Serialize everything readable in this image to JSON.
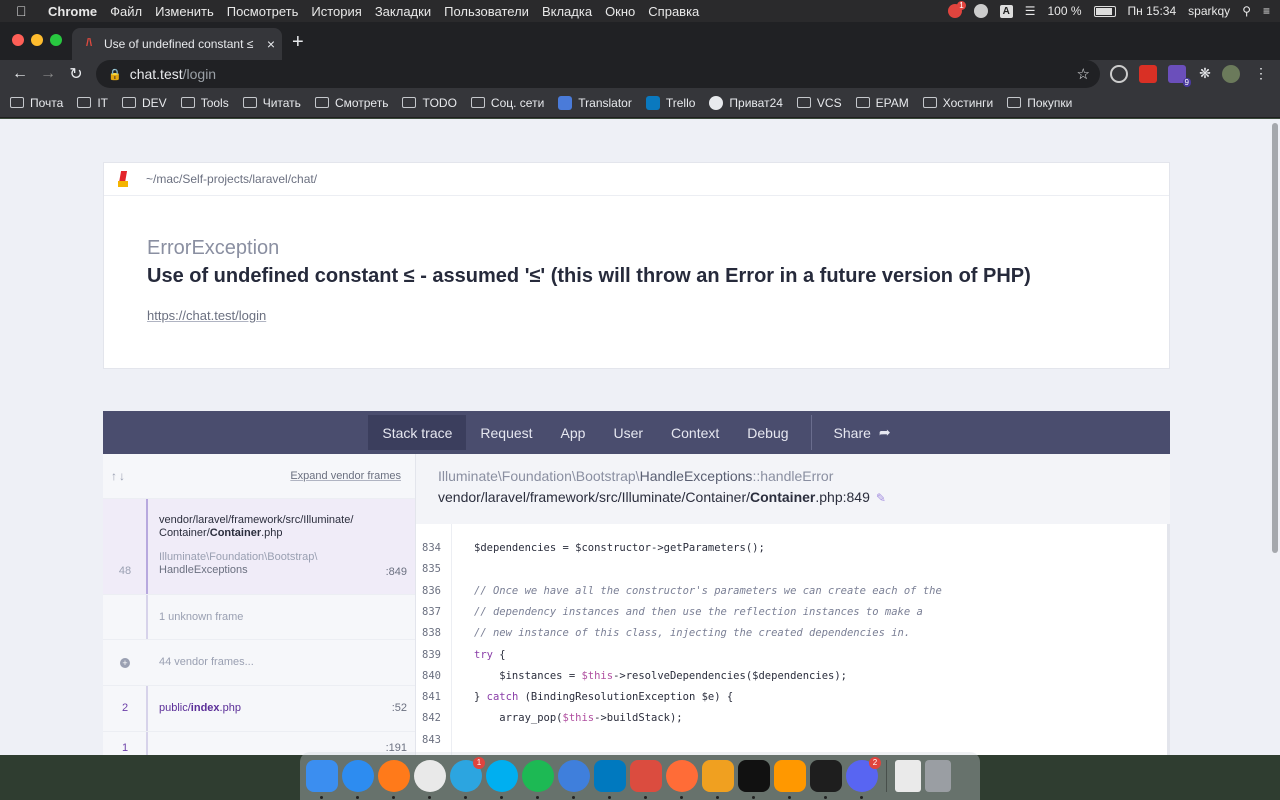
{
  "menubar": {
    "app": "Chrome",
    "items": [
      "Файл",
      "Изменить",
      "Посмотреть",
      "История",
      "Закладки",
      "Пользователи",
      "Вкладка",
      "Окно",
      "Справка"
    ],
    "notification_count": "1",
    "battery": "100 %",
    "clock": "Пн 15:34",
    "user": "sparkqy"
  },
  "browser": {
    "tab_title": "Use of undefined constant ≤",
    "url_host": "chat.test",
    "url_path": "/login",
    "extension_badge": "9",
    "bookmarks": [
      "Почта",
      "IT",
      "DEV",
      "Tools",
      "Читать",
      "Смотреть",
      "TODO",
      "Соц. сети",
      "Translator",
      "Trello",
      "Приват24",
      "VCS",
      "EPAM",
      "Хостинги",
      "Покупки"
    ]
  },
  "error": {
    "project_path": "~/mac/Self-projects/laravel/chat/",
    "exception_class": "ErrorException",
    "message": "Use of undefined constant ≤ - assumed '≤' (this will throw an Error in a future version of PHP)",
    "url": "https://chat.test/login"
  },
  "ignition_nav": {
    "items": [
      "Stack trace",
      "Request",
      "App",
      "User",
      "Context",
      "Debug"
    ],
    "active": "Stack trace",
    "share": "Share"
  },
  "frames": {
    "arrows": "↑↓",
    "expand_label": "Expand vendor frames",
    "selected": {
      "number": "48",
      "file_prefix": "vendor/laravel/framework/src/Illuminate/",
      "file_dir": "Container/",
      "file_name": "Container",
      "file_ext": ".php",
      "class_line1": "Illuminate\\Foundation\\Bootstrap\\",
      "class_line2": "HandleExceptions",
      "line": ":849"
    },
    "unknown": "1 unknown frame",
    "vendor": "44 vendor frames...",
    "app_frame": {
      "number": "2",
      "dir": "public/",
      "name": "index",
      "ext": ".php",
      "line": ":52"
    },
    "last_frame": {
      "number": "1",
      "line": ":191"
    }
  },
  "code": {
    "class_prefix": "Illuminate\\Foundation\\Bootstrap\\",
    "class_name": "HandleExceptions",
    "method": "::handleError",
    "file_prefix": "vendor/laravel/framework/src/Illuminate/Container/",
    "file_name": "Container",
    "file_suffix": ".php:849",
    "lines": [
      {
        "n": "834",
        "text": "$dependencies = $constructor->getParameters();",
        "kind": "code"
      },
      {
        "n": "835",
        "text": "",
        "kind": "code"
      },
      {
        "n": "836",
        "text": "// Once we have all the constructor's parameters we can create each of the",
        "kind": "comment"
      },
      {
        "n": "837",
        "text": "// dependency instances and then use the reflection instances to make a",
        "kind": "comment"
      },
      {
        "n": "838",
        "text": "// new instance of this class, injecting the created dependencies in.",
        "kind": "comment"
      },
      {
        "n": "839",
        "text": "try {",
        "kind": "code"
      },
      {
        "n": "840",
        "text": "    $instances = $this->resolveDependencies($dependencies);",
        "kind": "code"
      },
      {
        "n": "841",
        "text": "} catch (BindingResolutionException $e) {",
        "kind": "code"
      },
      {
        "n": "842",
        "text": "    array_pop($this->buildStack);",
        "kind": "code"
      },
      {
        "n": "843",
        "text": "",
        "kind": "code"
      }
    ]
  },
  "dock": {
    "apps": [
      "finder-icon",
      "safari-icon",
      "firefox-icon",
      "chrome-icon",
      "telegram-icon",
      "skype-icon",
      "spotify-icon",
      "copilot-icon",
      "trello-icon",
      "todoist-icon",
      "postman-icon",
      "tableplus-icon",
      "phpstorm-icon",
      "sublime-icon",
      "terminal-icon",
      "discord-icon"
    ],
    "telegram_badge": "1",
    "discord_badge": "2"
  },
  "colors": {
    "nav_bg": "#4a4d6e",
    "nav_active": "#3b3e5d",
    "frame_selected": "#f0ecf8",
    "accent_purple": "#8a3ea8"
  }
}
